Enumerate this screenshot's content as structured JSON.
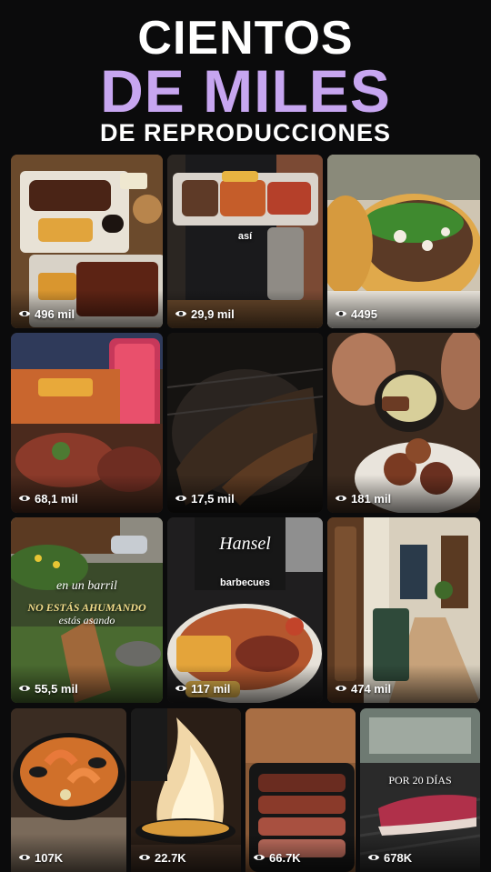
{
  "headline": {
    "line1": "CIENTOS",
    "line2": "DE MILES",
    "line3": "DE REPRODUCCIONES",
    "accent_color": "#c7a6f0"
  },
  "icon": "eye-icon",
  "tiles": [
    {
      "views": "496 mil"
    },
    {
      "views": "29,9 mil",
      "caption": "así"
    },
    {
      "views": "4495"
    },
    {
      "views": "68,1 mil"
    },
    {
      "views": "17,5 mil"
    },
    {
      "views": "181 mil"
    },
    {
      "views": "55,5 mil",
      "caption1": "en un barril",
      "caption2": "NO ESTÁS AHUMANDO",
      "caption3": "estás asando"
    },
    {
      "views": "117 mil",
      "brand": "Hansel",
      "caption": "barbecues"
    },
    {
      "views": "474 mil"
    },
    {
      "views": "107K"
    },
    {
      "views": "22.7K"
    },
    {
      "views": "66.7K"
    },
    {
      "views": "678K",
      "caption": "POR 20 DÍAS"
    }
  ]
}
